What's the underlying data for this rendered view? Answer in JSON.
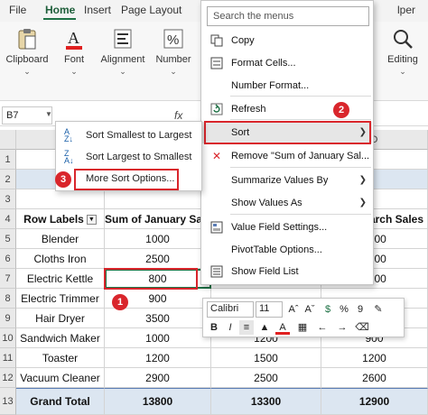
{
  "ribbon": {
    "tabs": [
      "File",
      "Home",
      "Insert",
      "Page Layout",
      "lper"
    ],
    "active_tab": "Home",
    "groups": [
      {
        "label": "Clipboard",
        "icon": "clipboard-icon"
      },
      {
        "label": "Font",
        "icon": "font-icon"
      },
      {
        "label": "Alignment",
        "icon": "alignment-icon"
      },
      {
        "label": "Number",
        "icon": "percent-icon"
      },
      {
        "label": "Editing",
        "icon": "search-icon"
      }
    ]
  },
  "formula_bar": {
    "name_box": "B7",
    "fx": "fx"
  },
  "grid": {
    "columns": [
      "A",
      "B",
      "C",
      "D"
    ],
    "rows": [
      "1",
      "2",
      "3",
      "4",
      "5",
      "6",
      "7",
      "8",
      "9",
      "10",
      "11",
      "12",
      "13"
    ],
    "pivot_headers": [
      "Row Labels",
      "Sum of January Sales",
      "",
      "arch Sales"
    ],
    "pivot_rows": [
      {
        "label": "Blender",
        "jan": "1000",
        "feb": "",
        "mar": "1000"
      },
      {
        "label": "Cloths Iron",
        "jan": "2500",
        "feb": "",
        "mar": "2500"
      },
      {
        "label": "Electric Kettle",
        "jan": "800",
        "feb": "700",
        "mar": "1200"
      },
      {
        "label": "Electric Trimmer",
        "jan": "900",
        "feb": "",
        "mar": ""
      },
      {
        "label": "Hair Dryer",
        "jan": "3500",
        "feb": "",
        "mar": ""
      },
      {
        "label": "Sandwich Maker",
        "jan": "1000",
        "feb": "1200",
        "mar": "900"
      },
      {
        "label": "Toaster",
        "jan": "1200",
        "feb": "1500",
        "mar": "1200"
      },
      {
        "label": "Vacuum Cleaner",
        "jan": "2900",
        "feb": "2500",
        "mar": "2600"
      }
    ],
    "grand_total": {
      "label": "Grand Total",
      "jan": "13800",
      "feb": "13300",
      "mar": "12900"
    }
  },
  "context_menu": {
    "search_placeholder": "Search the menus",
    "items": [
      {
        "label": "Copy",
        "icon": "copy-icon"
      },
      {
        "label": "Format Cells...",
        "icon": "format-cells-icon"
      },
      {
        "label": "Number Format...",
        "icon": ""
      },
      {
        "label": "Refresh",
        "icon": "refresh-icon"
      },
      {
        "label": "Sort",
        "icon": ""
      },
      {
        "label": "Remove \"Sum of January Sal...",
        "icon": "remove-icon"
      },
      {
        "label": "Summarize Values By",
        "icon": ""
      },
      {
        "label": "Show Values As",
        "icon": ""
      },
      {
        "label": "Value Field Settings...",
        "icon": "field-settings-icon"
      },
      {
        "label": "PivotTable Options...",
        "icon": ""
      },
      {
        "label": "Show Field List",
        "icon": "field-list-icon"
      }
    ]
  },
  "sort_submenu": {
    "items": [
      "Sort Smallest to Largest",
      "Sort Largest to Smallest",
      "More Sort Options..."
    ]
  },
  "mini_toolbar": {
    "font": "Calibri",
    "size": "11"
  },
  "callouts": [
    "1",
    "2",
    "3"
  ],
  "colors": {
    "accent": "#1e7145",
    "callout": "#d9262c",
    "pivot_band": "#dce6f1"
  }
}
